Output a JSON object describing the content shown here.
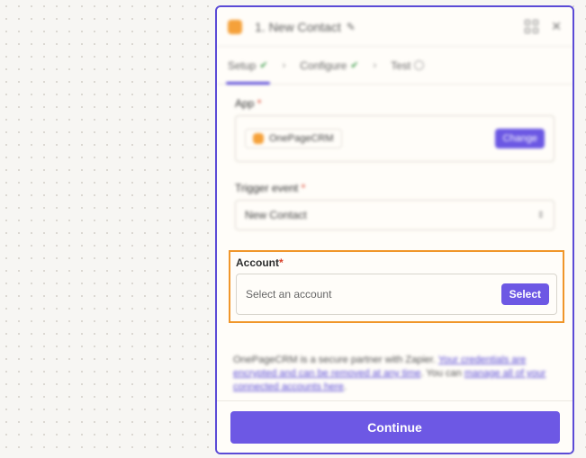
{
  "header": {
    "title": "1. New Contact",
    "edit_icon": "pencil-icon",
    "expand_icon": "grid-icon",
    "close_icon": "close-icon"
  },
  "tabs": [
    {
      "label": "Setup",
      "status": "complete",
      "active": true
    },
    {
      "label": "Configure",
      "status": "complete",
      "active": false
    },
    {
      "label": "Test",
      "status": "pending",
      "active": false
    }
  ],
  "app": {
    "label": "App",
    "name": "OnePageCRM",
    "change_label": "Change"
  },
  "trigger": {
    "label": "Trigger event",
    "value": "New Contact"
  },
  "account": {
    "label": "Account",
    "placeholder": "Select an account",
    "select_label": "Select"
  },
  "description": {
    "text_before": "OnePageCRM is a secure partner with Zapier. ",
    "link1": "Your credentials are encrypted and can be removed at any time",
    "text_mid": ". You can ",
    "link2": "manage all of your connected accounts here",
    "text_after": "."
  },
  "footer": {
    "continue_label": "Continue"
  },
  "colors": {
    "accent": "#6d58e4",
    "highlight_border": "#f0962a",
    "required": "#d9432d",
    "app_brand": "#f5a13a"
  }
}
